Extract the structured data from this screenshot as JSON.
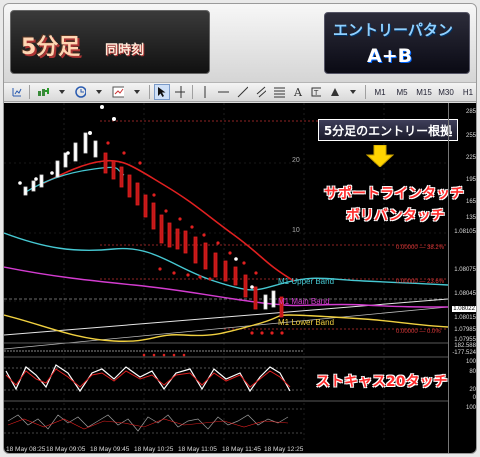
{
  "banner": {
    "title_main": "5分足",
    "title_sub": "同時刻",
    "right_line1": "エントリーパタン",
    "right_line2": "A+B"
  },
  "toolbar": {
    "timeframes": [
      "M1",
      "M5",
      "M15",
      "M30",
      "H1"
    ]
  },
  "annotations": {
    "callout": "5分足のエントリー根拠",
    "support_touch": "サポートラインタッチ",
    "bollinger_touch": "ボリバンタッチ",
    "stoch_touch": "ストキャス20タッチ"
  },
  "bands": {
    "upper": "M1 Upper Band",
    "main": "M1 Main Band",
    "lower": "M1 Lower Band"
  },
  "grid_labels": [
    "20",
    "10"
  ],
  "fib_labels": [
    "0.00000 — 38.2%",
    "0.00000 — 23.6%",
    "0.00000 — 0.0%"
  ],
  "price_axis": [
    "285",
    "255",
    "225",
    "195",
    "165",
    "135",
    "1.08105",
    "1.08075",
    "1.08045",
    "1.08022",
    "1.08015",
    "1.07985",
    "1.07955"
  ],
  "stoch_axis": [
    "182.588",
    "-177.524"
  ],
  "lower_axis": [
    "100",
    "80",
    "20",
    "0",
    "100"
  ],
  "time_axis": [
    "18 May 08:25",
    "18 May 09:05",
    "18 May 09:45",
    "18 May 10:25",
    "18 May 11:05",
    "18 May 11:45",
    "18 May 12:25"
  ],
  "colors": {
    "accent_red": "#ff2b2b",
    "upper_band": "#46c8d2",
    "main_band": "#d33cd0",
    "lower_band": "#f0d040",
    "background": "#000000"
  }
}
